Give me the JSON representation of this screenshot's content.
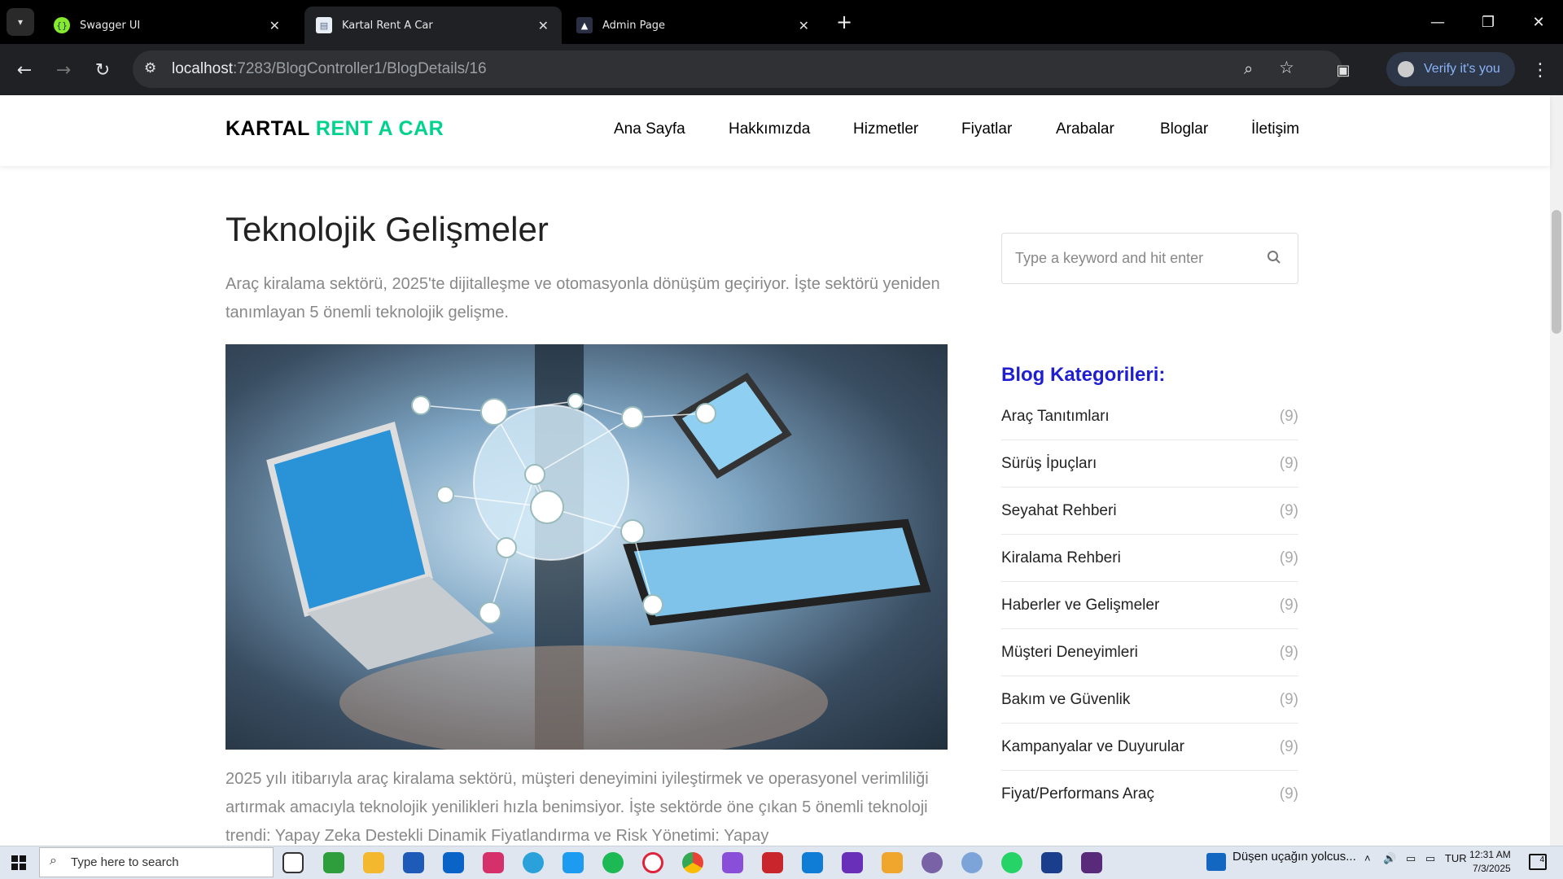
{
  "browser": {
    "tabs": [
      {
        "title": "Swagger UI",
        "icon": "swagger-icon",
        "active": false
      },
      {
        "title": "Kartal Rent A Car",
        "icon": "page-icon",
        "active": true
      },
      {
        "title": "Admin Page",
        "icon": "admin-icon",
        "active": false
      }
    ],
    "url_host": "localhost",
    "url_rest": ":7283/BlogController1/BlogDetails/16",
    "verify_label": "Verify it's you"
  },
  "site": {
    "logo_main": "KARTAL",
    "logo_accent": "RENT A CAR",
    "nav": [
      "Ana Sayfa",
      "Hakkımızda",
      "Hizmetler",
      "Fiyatlar",
      "Arabalar",
      "Bloglar",
      "İletişim"
    ]
  },
  "article": {
    "title": "Teknolojik Gelişmeler",
    "intro": "Araç kiralama sektörü, 2025'te dijitalleşme ve otomasyonla dönüşüm geçiriyor. İşte sektörü yeniden tanımlayan 5 önemli teknolojik gelişme.",
    "body": "2025 yılı itibarıyla araç kiralama sektörü, müşteri deneyimini iyileştirmek ve operasyonel verimliliği artırmak amacıyla teknolojik yenilikleri hızla benimsiyor. İşte sektörde öne çıkan 5 önemli teknoloji trendi: Yapay Zeka Destekli Dinamik Fiyatlandırma ve Risk Yönetimi: Yapay"
  },
  "sidebar": {
    "search_placeholder": "Type a keyword and hit enter",
    "categories_title": "Blog Kategorileri:",
    "categories": [
      {
        "name": "Araç Tanıtımları",
        "count": "(9)"
      },
      {
        "name": "Sürüş İpuçları",
        "count": "(9)"
      },
      {
        "name": "Seyahat Rehberi",
        "count": "(9)"
      },
      {
        "name": "Kiralama Rehberi",
        "count": "(9)"
      },
      {
        "name": "Haberler ve Gelişmeler",
        "count": "(9)"
      },
      {
        "name": "Müşteri Deneyimleri",
        "count": "(9)"
      },
      {
        "name": "Bakım ve Güvenlik",
        "count": "(9)"
      },
      {
        "name": "Kampanyalar ve Duyurular",
        "count": "(9)"
      },
      {
        "name": "Fiyat/Performans Araç",
        "count": "(9)"
      }
    ]
  },
  "taskbar": {
    "search_placeholder": "Type here to search",
    "news": "Düşen uçağın yolcus...",
    "lang": "TUR",
    "time": "12:31 AM",
    "date": "7/3/2025",
    "notif_count": "4"
  },
  "colors": {
    "accent_green": "#01d28e",
    "category_title": "#1f1fd1"
  }
}
